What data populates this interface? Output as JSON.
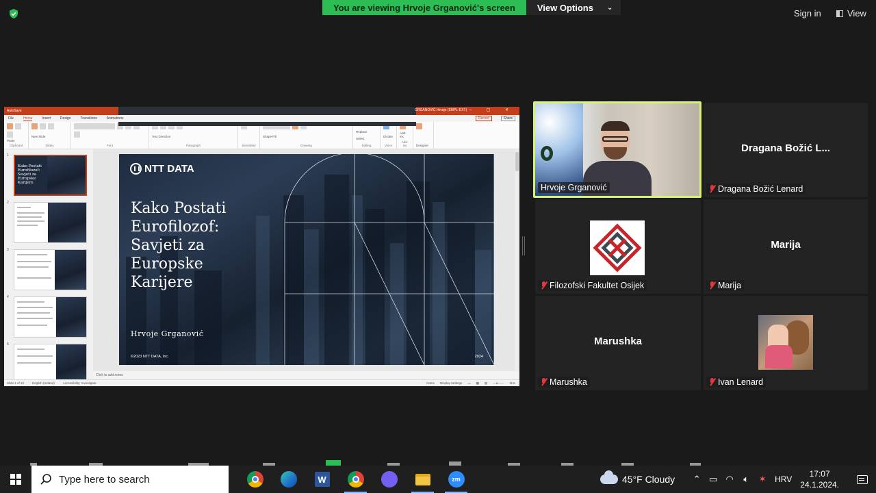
{
  "zoom": {
    "banner_text": "You are viewing Hrvoje Grganović's screen",
    "view_options_label": "View Options",
    "signin_label": "Sign in",
    "view_label": "View",
    "accent_green": "#2dbd55",
    "active_speaker_border": "#d6f27a"
  },
  "powerpoint": {
    "autosave_label": "AutoSave",
    "window_user": "GRGANOVIĆ Hrvoje (EMPL-EXT)",
    "tabs": [
      "File",
      "Home",
      "Insert",
      "Design",
      "Transitions",
      "Animations"
    ],
    "record_label": "Record",
    "share_label": "Share",
    "ribbon_groups": [
      "Clipboard",
      "Slides",
      "Font",
      "Paragraph",
      "Sensitivity",
      "Drawing",
      "Editing",
      "Voice",
      "Add-ins",
      "Designer"
    ],
    "ribbon_labels": {
      "paste": "Paste",
      "new_slide": "New Slide",
      "reuse_slides": "Reuse Slides",
      "layout": "Layout",
      "reset": "Reset",
      "section": "Section",
      "text_direction": "Text Direction",
      "align_text": "Align Text",
      "convert_smartart": "Convert to SmartArt",
      "arrange": "Arrange",
      "quick_styles": "Quick Styles",
      "shape_fill": "Shape Fill",
      "shape_outline": "Shape Outline",
      "shape_effects": "Shape Effects",
      "find": "Find",
      "replace": "Replace",
      "select": "Select",
      "dictate": "Dictate",
      "add_ins": "Add-ins",
      "designer": "Designer"
    },
    "thumb_numbers": [
      "1",
      "2",
      "3",
      "4",
      "5"
    ],
    "slide": {
      "logo_text": "NTT DATA",
      "title_lines": [
        "Kako Postati",
        "Eurofilozof:",
        "Savjeti za",
        "Europske",
        "Karijere"
      ],
      "author": "Hrvoje Grganović",
      "copyright": "©2023 NTT DATA, Inc.",
      "year": "2024"
    },
    "notes_placeholder": "Click to add notes",
    "status": {
      "slide_count": "Slide 1 of 10",
      "language": "English (Ireland)",
      "accessibility": "Accessibility: Investigate",
      "notes_btn": "Notes",
      "display_settings": "Display Settings",
      "zoom_level": "11%"
    }
  },
  "participants": [
    {
      "name": "Hrvoje Grganović",
      "muted": false,
      "active": true
    },
    {
      "display": "Dragana Božić L...",
      "name": "Dragana Božić Lenard",
      "muted": true
    },
    {
      "name": "Filozofski Fakultet Osijek",
      "muted": true
    },
    {
      "display": "Marija",
      "name": "Marija",
      "muted": true
    },
    {
      "display": "Marushka",
      "name": "Marushka",
      "muted": true
    },
    {
      "name": "Ivan Lenard",
      "muted": true
    }
  ],
  "taskbar": {
    "search_placeholder": "Type here to search",
    "apps": [
      "chrome-icon",
      "edge-icon",
      "word-icon",
      "chrome-profile-icon",
      "viber-icon",
      "file-explorer-icon",
      "zoom-icon"
    ],
    "weather": "45°F  Cloudy",
    "language": "HRV",
    "time": "17:07",
    "date": "24.1.2024."
  }
}
